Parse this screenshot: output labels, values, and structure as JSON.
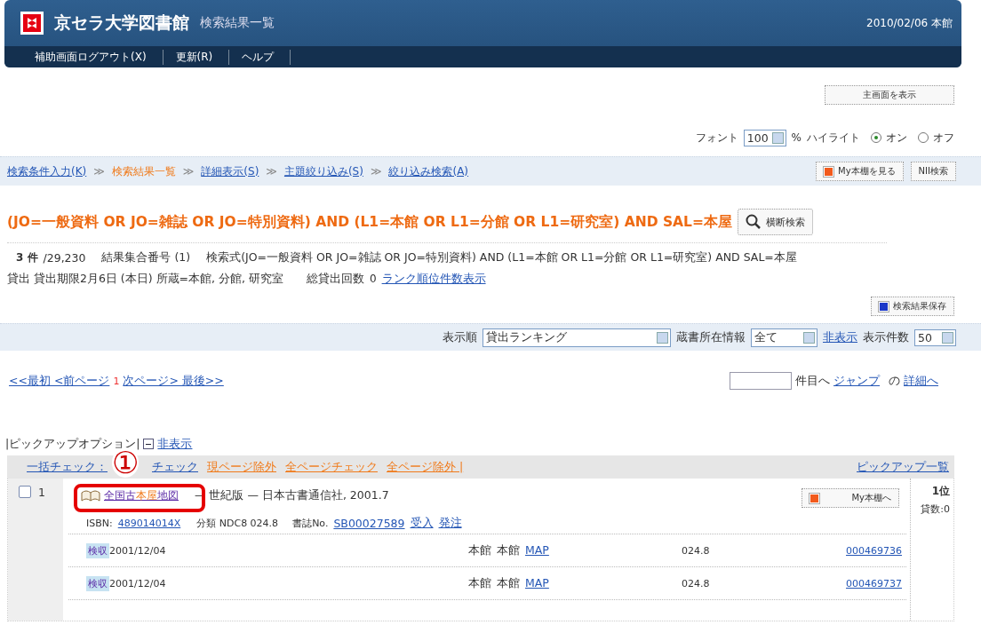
{
  "header": {
    "library_name": "京セラ大学図書館",
    "page_title": "検索結果一覧",
    "date_location": "2010/02/06 本館"
  },
  "nav": [
    {
      "label": "補助画面ログアウト(X)"
    },
    {
      "label": "更新(R)"
    },
    {
      "label": "ヘルプ"
    }
  ],
  "main_screen_button": "主画面を表示",
  "font_control": {
    "label": "フォント",
    "value": "100",
    "unit": "%",
    "highlight_label": "ハイライト",
    "options": [
      {
        "label": "オン",
        "selected": true
      },
      {
        "label": "オフ",
        "selected": false
      }
    ]
  },
  "breadcrumb": {
    "separator": "≫",
    "items": [
      {
        "label": "検索条件入力(K)",
        "current": false
      },
      {
        "label": "検索結果一覧",
        "current": true
      },
      {
        "label": "詳細表示(S)",
        "current": false
      },
      {
        "label": "主題絞り込み(S)",
        "current": false
      },
      {
        "label": "絞り込み検索(A)",
        "current": false
      }
    ],
    "buttons": [
      "My本棚を見る",
      "NII検索"
    ]
  },
  "query_heading": "(JO=一般資料 OR JO=雑誌 OR JO=特別資料) AND (L1=本館 OR L1=分館 OR L1=研究室) AND SAL=本屋",
  "cross_search_button": "横断検索",
  "summary": {
    "count": "3 件",
    "total": "/29,230",
    "set_number": "結果集合番号 (1)",
    "expression": "検索式(JO=一般資料 OR JO=雑誌 OR JO=特別資料) AND (L1=本館 OR L1=分館 OR L1=研究室) AND SAL=本屋",
    "loan_info": "貸出 貸出期限2月6日 (本日) 所蔵=本館, 分館, 研究室",
    "total_loans_label": "総貸出回数",
    "total_loans": "0",
    "rank_link": "ランク順位件数表示"
  },
  "save_button": "検索結果保存",
  "sort_bar": {
    "order_label": "表示順",
    "order_value": "貸出ランキング",
    "location_label": "蔵書所在情報",
    "location_value": "全て",
    "hide_link": "非表示",
    "count_label": "表示件数",
    "count_value": "50"
  },
  "paging": {
    "before": "<<最初 <前ページ",
    "current": "1",
    "after": "次ページ> 最後>>",
    "jump_suffix": "件目へ",
    "jump_link": "ジャンプ",
    "of_label": "の",
    "detail_link": "詳細へ"
  },
  "pickup": {
    "label": "|ピックアップオプション|",
    "hide_link": "非表示"
  },
  "check_bar": {
    "label": "一括チェック：",
    "links": [
      {
        "label": "チェック"
      },
      {
        "label": "現ページ除外"
      },
      {
        "label": "全ページチェック"
      },
      {
        "label": "全ページ除外 |"
      }
    ],
    "list_link": "ピックアップ一覧"
  },
  "annotation_number": "①",
  "records": [
    {
      "checked": false,
      "number": "1",
      "title_parts": [
        {
          "text": "全国古",
          "highlight": false
        },
        {
          "text": "本屋",
          "highlight": true
        },
        {
          "text": "地図",
          "highlight": false
        }
      ],
      "title_rest": "— 世紀版 — 日本古書通信社, 2001.7",
      "isbn_label": "ISBN:",
      "isbn": "489014014X",
      "classification": "分類 NDC8 024.8",
      "biblio_label": "書誌No.",
      "biblio_no": "SB00027589",
      "links": [
        "受入",
        "発注"
      ],
      "shelf_button": "My本棚へ",
      "rank": "1位",
      "loans": "貸数:0",
      "holdings": [
        {
          "status": "検収",
          "date": "2001/12/04",
          "library": "本館",
          "location": "本館",
          "map": "MAP",
          "call_no": "024.8",
          "item_no": "000469736"
        },
        {
          "status": "検収",
          "date": "2001/12/04",
          "library": "本館",
          "location": "本館",
          "map": "MAP",
          "call_no": "024.8",
          "item_no": "000469737"
        }
      ]
    }
  ]
}
